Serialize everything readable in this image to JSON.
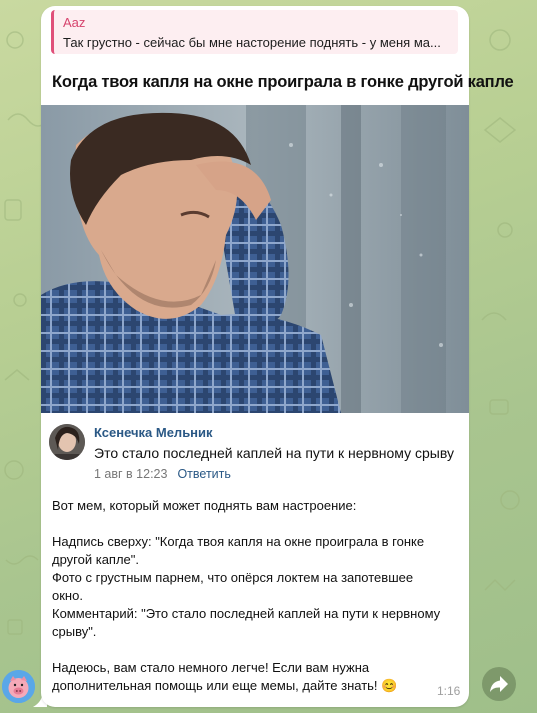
{
  "reply": {
    "author": "Aaz",
    "text": "Так грустно - сейчас бы мне насторение поднять - у меня ма..."
  },
  "meme": {
    "caption": "Когда твоя капля на окне проиграла в гонке другой капле",
    "comment": {
      "author": "Ксенечка Мельник",
      "text": "Это стало последней каплей на пути к нервному срыву",
      "date": "1 авг в 12:23",
      "reply_label": "Ответить"
    }
  },
  "message": {
    "line1": "Вот мем, который может поднять вам настроение:",
    "line2": "Надпись сверху: \"Когда твоя капля на окне проиграла в гонке",
    "line3": "другой капле\".",
    "line4": "Фото с грустным парнем, что опёрся локтем на запотевшее",
    "line5": "окно.",
    "line6": "Комментарий: \"Это стало последней каплей на пути к нервному",
    "line7": "срыву\".",
    "line8": "Надеюсь, вам стало немного легче! Если вам нужна",
    "line9": "дополнительная помощь или еще мемы, дайте знать! 😊",
    "time": "1:16"
  },
  "icons": {
    "user_avatar": "pig-face-avatar-icon",
    "forward": "forward-arrow-icon"
  },
  "colors": {
    "reply_accent": "#d6436d",
    "link_blue": "#2a5885",
    "background": "#b8cf93"
  }
}
